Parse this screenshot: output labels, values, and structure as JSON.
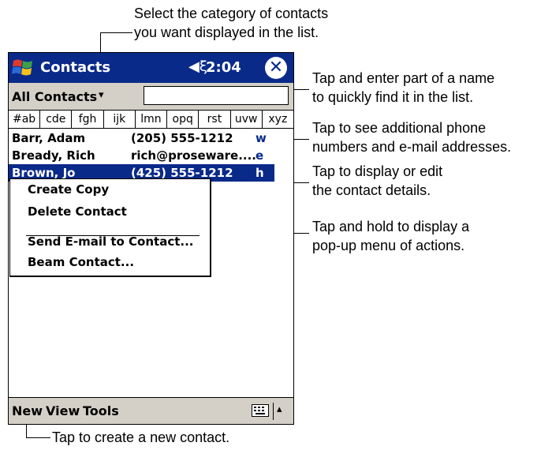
{
  "app": {
    "title": "Contacts",
    "speaker_icon": "speaker-icon",
    "time": "2:04",
    "close_symbol": "✕"
  },
  "category": {
    "label": "All Contacts",
    "arrow": "▾",
    "find_value": ""
  },
  "tabs": [
    "#ab",
    "cde",
    "fgh",
    "ijk",
    "lmn",
    "opq",
    "rst",
    "uvw",
    "xyz"
  ],
  "contacts": [
    {
      "name": "Barr, Adam",
      "info": "(205) 555-1212",
      "tag": "w",
      "selected": false
    },
    {
      "name": "Bready, Rich",
      "info": "rich@proseware.... ",
      "tag": "e",
      "selected": false
    },
    {
      "name": "Brown, Jo",
      "info": "(425) 555-1212",
      "tag": "h",
      "selected": true
    }
  ],
  "popup_menu": {
    "items": [
      "Create Copy",
      "Delete Contact",
      "Send E-mail to Contact...",
      "Beam Contact..."
    ]
  },
  "menubar": {
    "new_label": "New",
    "view_label": "View",
    "tools_label": "Tools",
    "sip_arrow": "▴"
  },
  "callouts": {
    "category": [
      "Select the category of contacts",
      "you want displayed in the list."
    ],
    "find": [
      "Tap and enter part of a name",
      "to quickly find it in the list."
    ],
    "tag": [
      "Tap to see additional phone",
      "numbers and e-mail addresses."
    ],
    "details": [
      "Tap to display or edit",
      "the contact details."
    ],
    "hold": [
      "Tap and hold to display a",
      "pop-up menu of actions."
    ],
    "new": [
      "Tap to create a new contact."
    ]
  },
  "colors": {
    "title_bar": "#0a2a8a",
    "bar_gray": "#d4d0c8",
    "selection": "#0a2a8a"
  }
}
